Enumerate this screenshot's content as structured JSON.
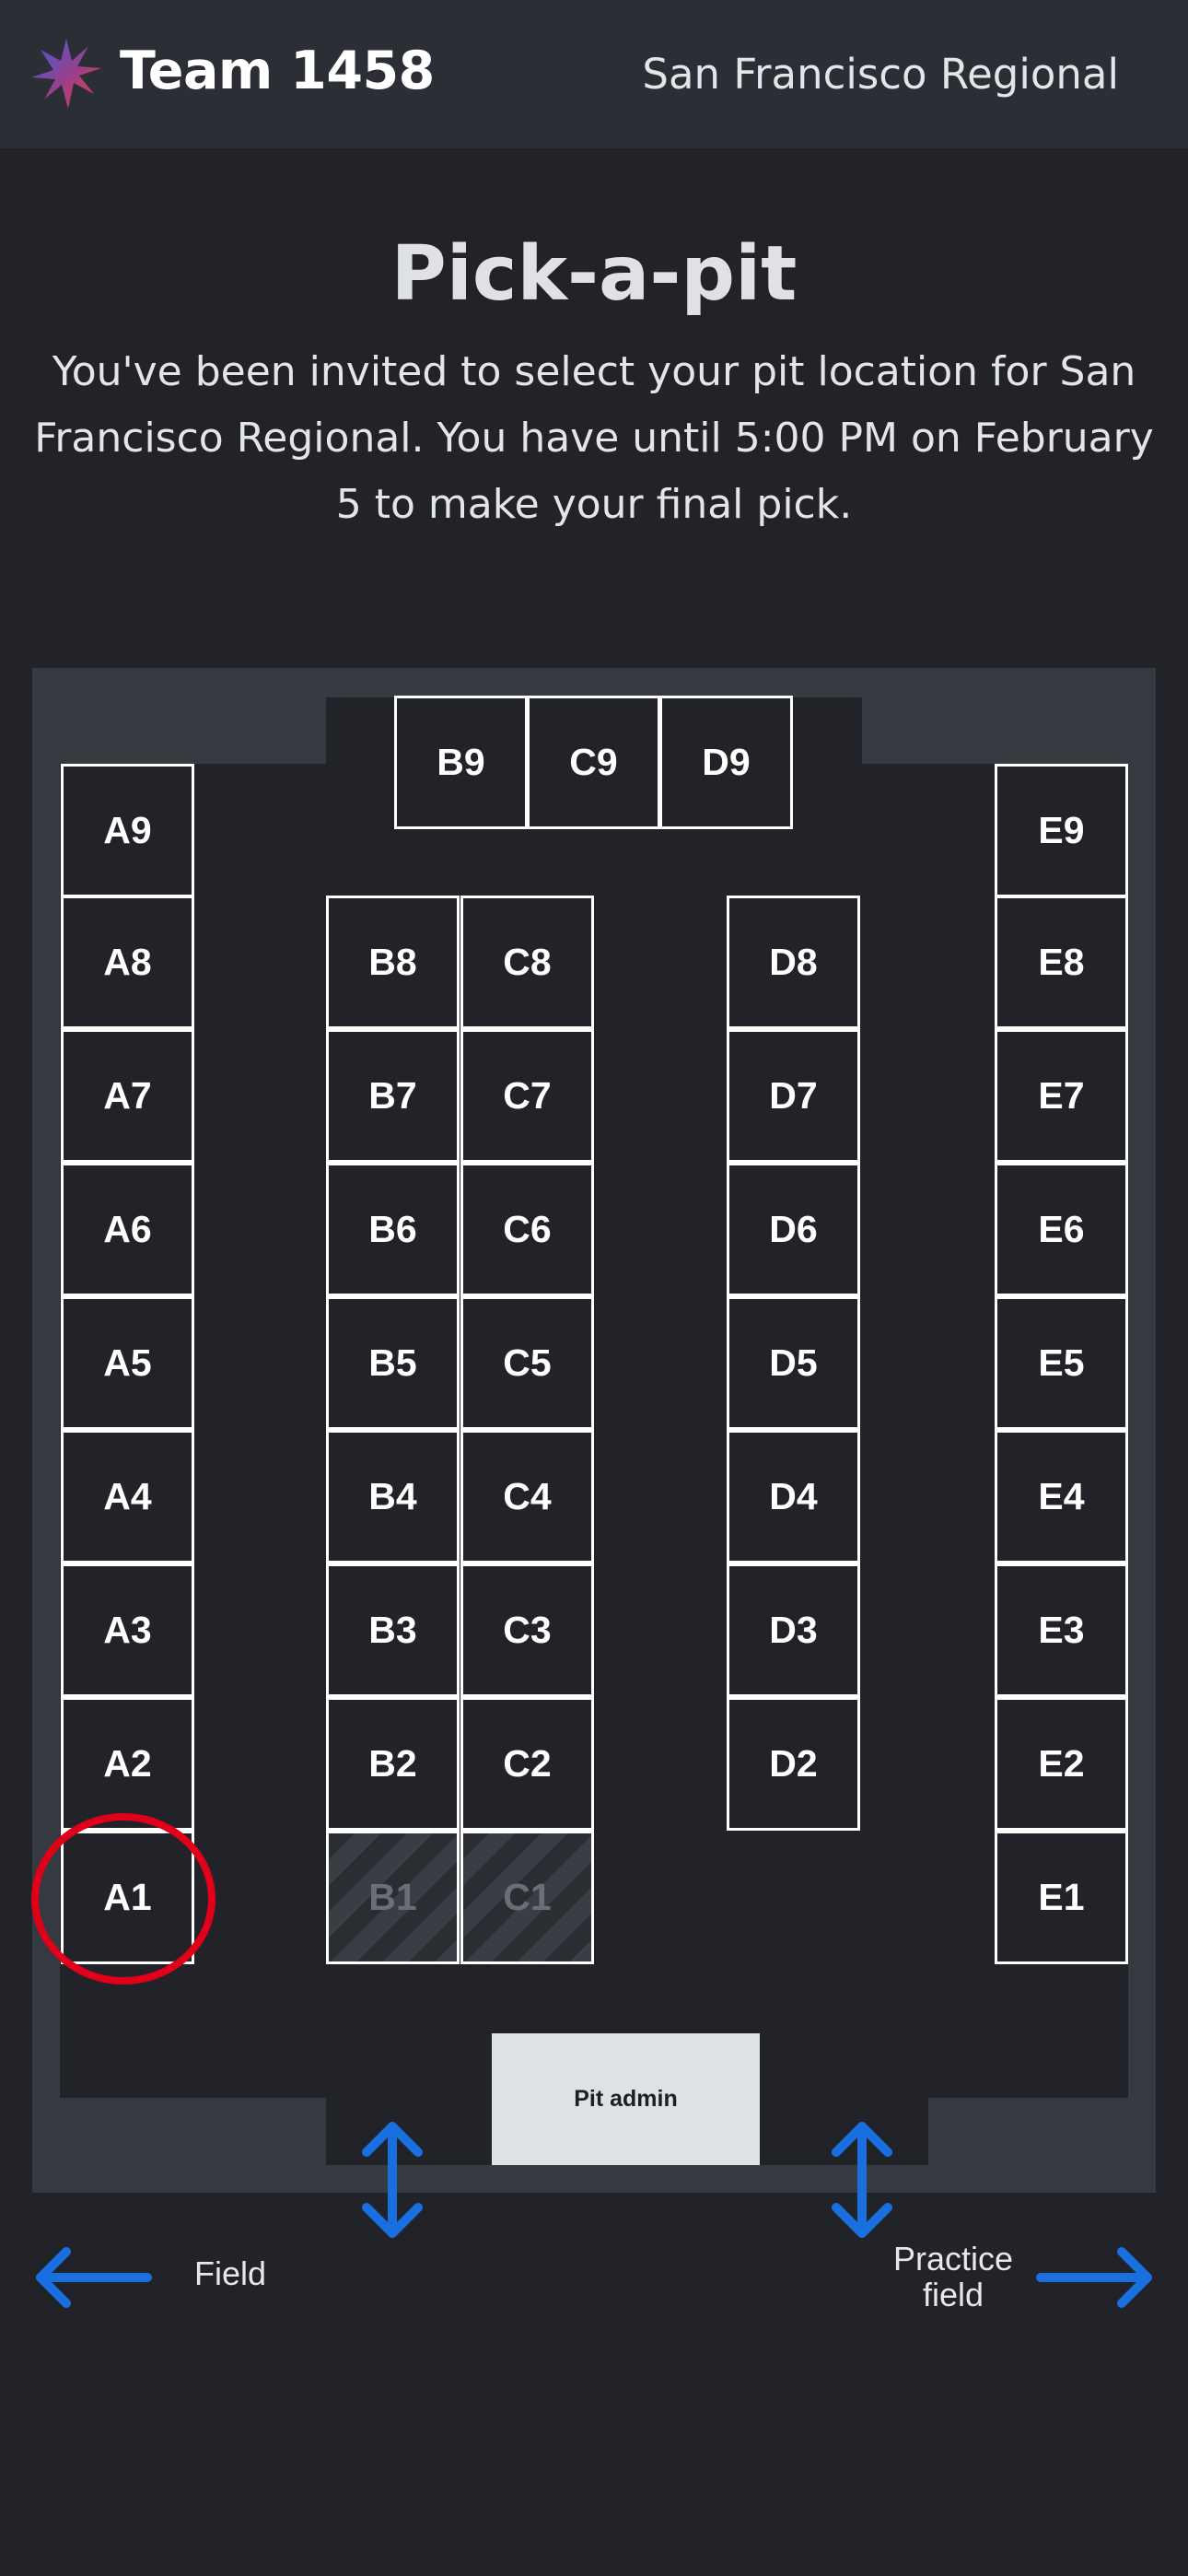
{
  "header": {
    "team_name": "Team 1458",
    "event_name": "San Francisco Regional"
  },
  "main": {
    "title": "Pick-a-pit",
    "description": "You've been invited to select your pit location for San Francisco Regional. You have until 5:00 PM on February 5 to make your final pick."
  },
  "pit_map": {
    "selected_pit": "A1",
    "taken_pits": [
      "B1",
      "C1"
    ],
    "pits": {
      "A9": "A9",
      "A8": "A8",
      "A7": "A7",
      "A6": "A6",
      "A5": "A5",
      "A4": "A4",
      "A3": "A3",
      "A2": "A2",
      "A1": "A1",
      "B9": "B9",
      "B8": "B8",
      "B7": "B7",
      "B6": "B6",
      "B5": "B5",
      "B4": "B4",
      "B3": "B3",
      "B2": "B2",
      "B1": "B1",
      "C9": "C9",
      "C8": "C8",
      "C7": "C7",
      "C6": "C6",
      "C5": "C5",
      "C4": "C4",
      "C3": "C3",
      "C2": "C2",
      "C1": "C1",
      "D9": "D9",
      "D8": "D8",
      "D7": "D7",
      "D6": "D6",
      "D5": "D5",
      "D4": "D4",
      "D3": "D3",
      "D2": "D2",
      "E9": "E9",
      "E8": "E8",
      "E7": "E7",
      "E6": "E6",
      "E5": "E5",
      "E4": "E4",
      "E3": "E3",
      "E2": "E2",
      "E1": "E1"
    },
    "pit_admin_label": "Pit admin",
    "field_label": "Field",
    "practice_field_label": "Practice field",
    "colors": {
      "arrow": "#1a6fe0",
      "selection_ring": "#e0001a"
    }
  }
}
